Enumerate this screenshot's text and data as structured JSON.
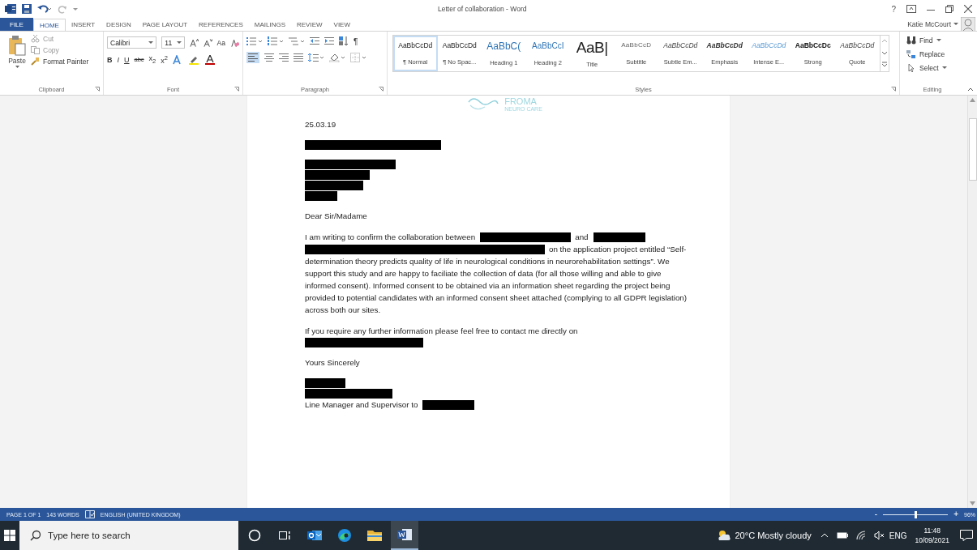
{
  "title_bar": {
    "title": "Letter of collaboration - Word",
    "help": "?"
  },
  "tabs": [
    {
      "label": "FILE",
      "kind": "file",
      "selected": false
    },
    {
      "label": "HOME",
      "kind": "tab",
      "selected": true
    },
    {
      "label": "INSERT",
      "kind": "tab",
      "selected": false
    },
    {
      "label": "DESIGN",
      "kind": "tab",
      "selected": false
    },
    {
      "label": "PAGE LAYOUT",
      "kind": "tab",
      "selected": false
    },
    {
      "label": "REFERENCES",
      "kind": "tab",
      "selected": false
    },
    {
      "label": "MAILINGS",
      "kind": "tab",
      "selected": false
    },
    {
      "label": "REVIEW",
      "kind": "tab",
      "selected": false
    },
    {
      "label": "VIEW",
      "kind": "tab",
      "selected": false
    }
  ],
  "user": {
    "name": "Katie McCourt"
  },
  "clipboard": {
    "paste": "Paste",
    "cut": "Cut",
    "copy": "Copy",
    "format_painter": "Format Painter",
    "label": "Clipboard"
  },
  "font": {
    "family": "Calibri",
    "size": "11",
    "change_case": "Aa",
    "label": "Font",
    "buttons": [
      {
        "label": "B",
        "kind": "bold"
      },
      {
        "label": "I",
        "kind": "italic"
      },
      {
        "label": "U",
        "kind": "underline"
      },
      {
        "label": "abc",
        "kind": "strike"
      },
      {
        "label": "x$_{2}$",
        "kind": "plain"
      },
      {
        "label": "x$^{2}$",
        "kind": "plain"
      }
    ]
  },
  "paragraph": {
    "show_marks": "¶",
    "label": "Paragraph"
  },
  "styles": {
    "label": "Styles",
    "items": [
      {
        "preview": "AaBbCcDd",
        "name": "¶ Normal",
        "kind": "plain",
        "selected": true
      },
      {
        "preview": "AaBbCcDd",
        "name": "¶ No Spac...",
        "kind": "plain",
        "selected": false
      },
      {
        "preview": "AaBbC(",
        "name": "Heading 1",
        "kind": "heading1",
        "selected": false
      },
      {
        "preview": "AaBbCcI",
        "name": "Heading 2",
        "kind": "heading2",
        "selected": false
      },
      {
        "preview": "AaB|",
        "name": "Title",
        "kind": "title",
        "selected": false
      },
      {
        "preview": "AaBbCcD",
        "name": "Subtitle",
        "kind": "subtitle",
        "selected": false
      },
      {
        "preview": "AaBbCcDd",
        "name": "Subtle Em...",
        "kind": "italic",
        "selected": false
      },
      {
        "preview": "AaBbCcDd",
        "name": "Emphasis",
        "kind": "bolditalic",
        "selected": false
      },
      {
        "preview": "AaBbCcDd",
        "name": "Intense E...",
        "kind": "intense",
        "selected": false
      },
      {
        "preview": "AaBbCcDc",
        "name": "Strong",
        "kind": "strong",
        "selected": false
      },
      {
        "preview": "AaBbCcDd",
        "name": "Quote",
        "kind": "italic",
        "selected": false
      }
    ]
  },
  "editing": {
    "find": "Find",
    "replace": "Replace",
    "select": "Select",
    "label": "Editing"
  },
  "document": {
    "logo": {
      "name": "FROMA",
      "tagline": "NEURO CARE"
    },
    "paragraphs": [
      {
        "lines": [
          [
            {
              "kind": "text",
              "text": "25.03.19"
            }
          ]
        ]
      },
      {
        "lines": [
          [
            {
              "kind": "redaction"
            }
          ]
        ]
      },
      {
        "lines": [
          [
            {
              "kind": "redaction"
            }
          ],
          [
            {
              "kind": "redaction"
            }
          ],
          [
            {
              "kind": "redaction"
            }
          ],
          [
            {
              "kind": "redaction"
            }
          ]
        ]
      },
      {
        "lines": [
          [
            {
              "kind": "text",
              "text": "Dear Sir/Madame"
            }
          ]
        ]
      },
      {
        "lines": [
          [
            {
              "kind": "text",
              "text": "I am writing to confirm the collaboration between"
            },
            {
              "kind": "redaction"
            },
            {
              "kind": "text",
              "text": "and"
            },
            {
              "kind": "redaction"
            }
          ],
          [
            {
              "kind": "redaction"
            },
            {
              "kind": "text",
              "text": "on the application project entitled “Self-"
            }
          ],
          [
            {
              "kind": "text",
              "text": "determination theory predicts quality of life in neurological conditions in neurorehabilitation settings”. We support this study and are happy to faciliate the collection of data (for all those willing and able to give informed consent). Informed consent to be obtained via an information sheet regarding the project being provided to potential candidates with an informed consent sheet attached (complying to all GDPR legislation) across both our sites."
            }
          ]
        ]
      },
      {
        "lines": [
          [
            {
              "kind": "text",
              "text": "If you require any further information please feel free to contact me directly on"
            }
          ],
          [
            {
              "kind": "redaction"
            }
          ]
        ]
      },
      {
        "lines": [
          [
            {
              "kind": "text",
              "text": "Yours Sincerely"
            }
          ]
        ]
      },
      {
        "lines": [
          [
            {
              "kind": "redaction"
            }
          ],
          [
            {
              "kind": "redaction"
            }
          ],
          [
            {
              "kind": "text",
              "text": "Line Manager and Supervisor to"
            },
            {
              "kind": "redaction"
            }
          ]
        ]
      }
    ]
  },
  "status_bar": {
    "page": "PAGE 1 OF 1",
    "words": "143 WORDS",
    "language": "ENGLISH (UNITED KINGDOM)",
    "zoom_out": "-",
    "zoom_in": "+",
    "zoom": {
      "level": 0.5
    },
    "zoom_text": "96%"
  },
  "taskbar": {
    "search": {
      "placeholder": "Type here to search"
    },
    "apps": [
      {
        "kind": "cortana",
        "selected": false
      },
      {
        "kind": "taskview",
        "selected": false
      },
      {
        "kind": "outlook",
        "selected": false
      },
      {
        "kind": "edge",
        "selected": false
      },
      {
        "kind": "explorer",
        "selected": false
      },
      {
        "kind": "word",
        "selected": true
      }
    ],
    "weather": "20°C  Mostly cloudy",
    "language": "ENG",
    "time": "11:48",
    "date": "10/09/2021"
  }
}
